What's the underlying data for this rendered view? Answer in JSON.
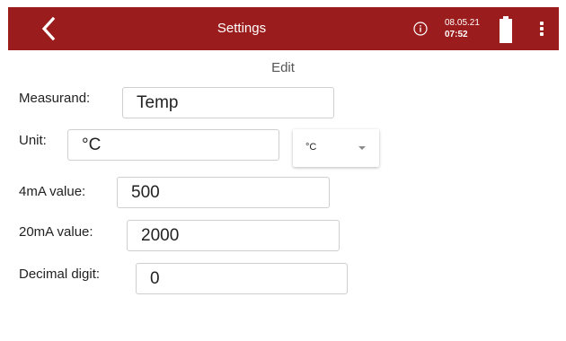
{
  "header": {
    "title": "Settings",
    "date": "08.05.21",
    "time": "07:52",
    "back_icon": "chevron-left-icon",
    "info_icon": "info-icon",
    "battery_icon": "battery-icon",
    "menu_icon": "more-vertical-icon",
    "background_color": "#9b1c1c"
  },
  "section_title": "Edit",
  "fields": {
    "measurand": {
      "label": "Measurand:",
      "value": "Temp"
    },
    "unit": {
      "label": "Unit:",
      "value": "°C",
      "selected_option": "°C"
    },
    "value_4ma": {
      "label": "4mA value:",
      "value": "500"
    },
    "value_20ma": {
      "label": "20mA value:",
      "value": "2000"
    },
    "decimal_digit": {
      "label": "Decimal digit:",
      "value": "0"
    }
  }
}
